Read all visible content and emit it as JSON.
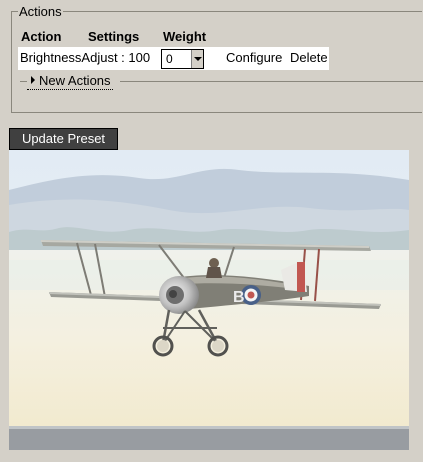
{
  "actions": {
    "legend": "Actions",
    "headers": {
      "action": "Action",
      "settings": "Settings",
      "weight": "Weight"
    },
    "row": {
      "label": "BrightnessAdjust : 100",
      "weight_value": "0",
      "configure_label": "Configure",
      "delete_label": "Delete"
    },
    "new_actions_label": "New Actions"
  },
  "update_button_label": "Update Preset",
  "photo": {
    "subject": "biplane",
    "roundel_letter": "B"
  }
}
